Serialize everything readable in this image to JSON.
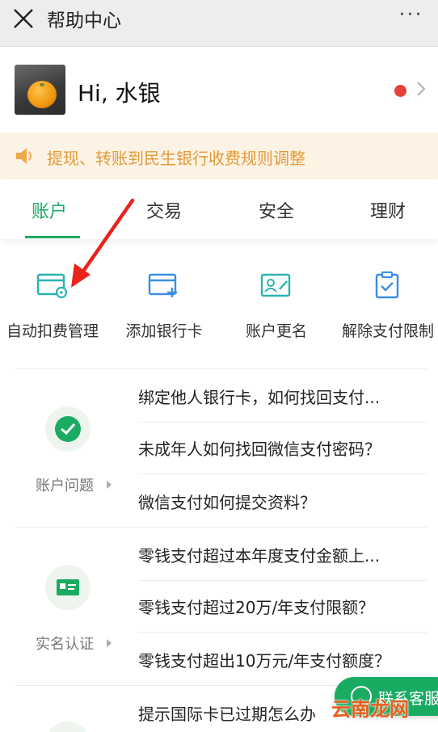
{
  "header": {
    "title": "帮助中心",
    "more_label": "···"
  },
  "profile": {
    "greeting": "Hi, 水银"
  },
  "notice": {
    "text": "提现、转账到民生银行收费规则调整"
  },
  "tabs": [
    {
      "label": "账户",
      "active": true
    },
    {
      "label": "交易",
      "active": false
    },
    {
      "label": "安全",
      "active": false
    },
    {
      "label": "理财",
      "active": false
    }
  ],
  "quick_actions": [
    {
      "label": "自动扣费管理",
      "icon": "card-gear-icon"
    },
    {
      "label": "添加银行卡",
      "icon": "card-add-icon"
    },
    {
      "label": "账户更名",
      "icon": "id-card-edit-icon"
    },
    {
      "label": "解除支付限制",
      "icon": "clipboard-check-icon"
    }
  ],
  "groups": [
    {
      "category": "账户问题",
      "icon": "wechat-pay-icon",
      "questions": [
        "绑定他人银行卡，如何找回支付...",
        "未成年人如何找回微信支付密码？",
        "微信支付如何提交资料？"
      ]
    },
    {
      "category": "实名认证",
      "icon": "id-card-icon",
      "questions": [
        "零钱支付超过本年度支付金额上...",
        "零钱支付超过20万/年支付限额？",
        "零钱支付超出10万元/年支付额度？"
      ]
    },
    {
      "category": "",
      "icon": "",
      "questions": [
        "提示国际卡已过期怎么办"
      ]
    }
  ],
  "contact": {
    "label": "联系客服"
  },
  "watermark": "云南龙网",
  "colors": {
    "accent": "#1aab63",
    "notice_text": "#e39a3a",
    "notice_bg": "#fcf3e4",
    "red_dot": "#e5403c",
    "annotation": "#e8231c"
  }
}
